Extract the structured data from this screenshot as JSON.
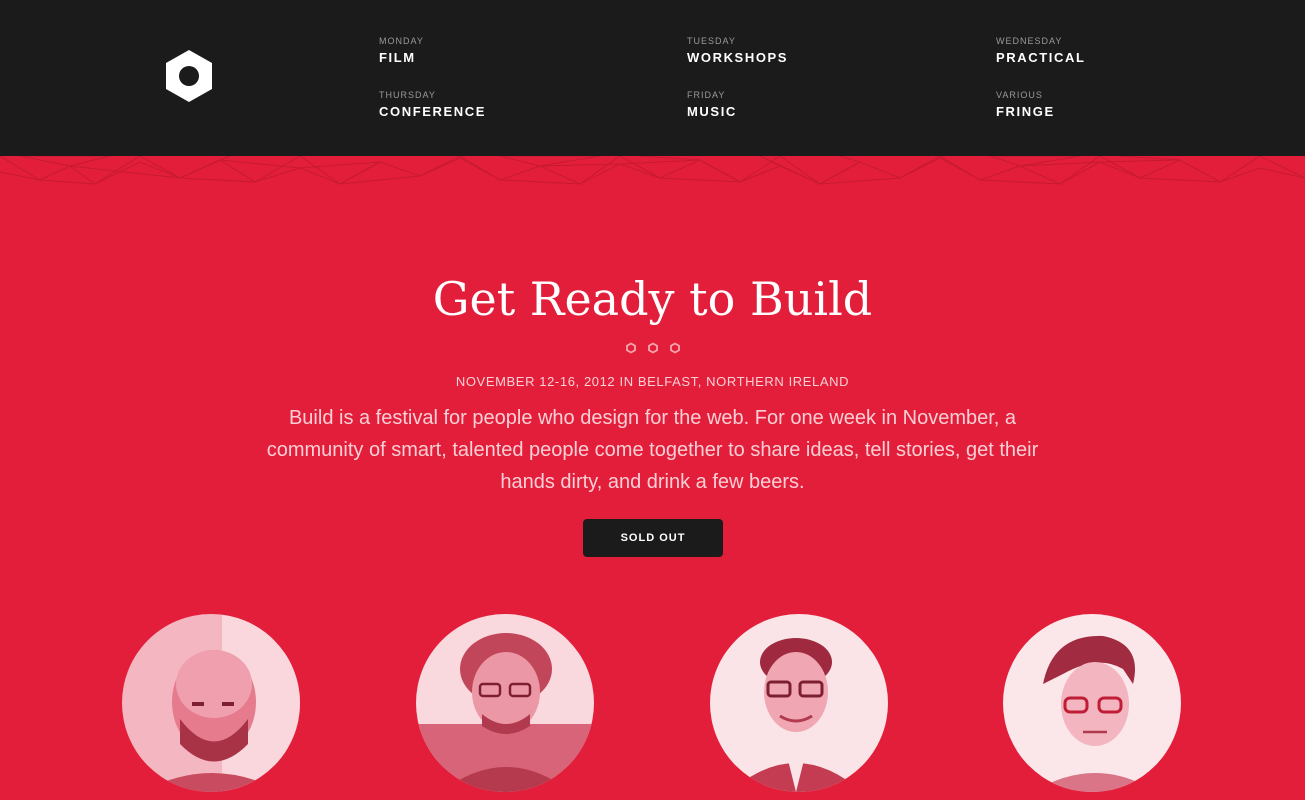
{
  "header": {
    "nav": [
      {
        "day": "MONDAY",
        "title": "FILM"
      },
      {
        "day": "TUESDAY",
        "title": "WORKSHOPS"
      },
      {
        "day": "WEDNESDAY",
        "title": "PRACTICAL"
      },
      {
        "day": "THURSDAY",
        "title": "CONFERENCE"
      },
      {
        "day": "FRIDAY",
        "title": "MUSIC"
      },
      {
        "day": "VARIOUS",
        "title": "FRINGE"
      }
    ]
  },
  "hero": {
    "title": "Get Ready to Build",
    "dates": "NOVEMBER 12-16, 2012 IN BELFAST, NORTHERN IRELAND",
    "intro": "Build is a festival for people who design for the web. For one week in November, a community of smart, talented people come together to share ideas, tell stories, get their hands dirty, and drink a few beers.",
    "button_label": "SOLD OUT"
  },
  "colors": {
    "accent": "#e31e3a",
    "header_bg": "#1b1b1c",
    "button_bg": "#1b1b1c"
  },
  "icons": [
    "hexagon-logo-icon",
    "hexagon-dot-icon"
  ]
}
